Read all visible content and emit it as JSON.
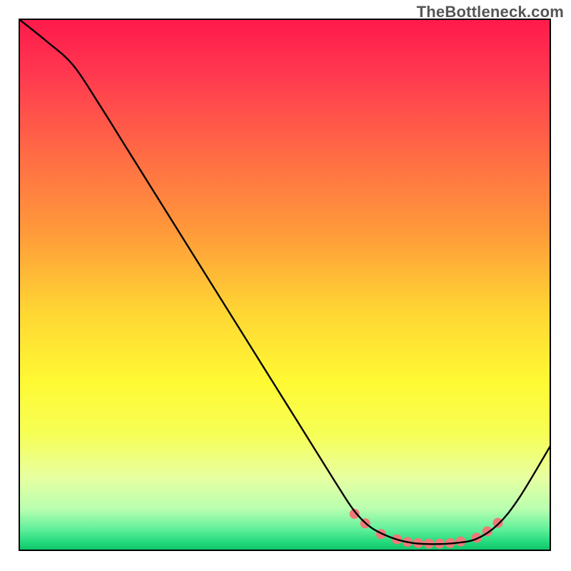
{
  "watermark": "TheBottleneck.com",
  "chart_data": {
    "type": "line",
    "title": "",
    "xlabel": "",
    "ylabel": "",
    "xlim": [
      0,
      100
    ],
    "ylim": [
      0,
      100
    ],
    "series": [
      {
        "name": "curve",
        "x": [
          0,
          5,
          10,
          15,
          20,
          25,
          30,
          35,
          40,
          45,
          50,
          55,
          60,
          63,
          66,
          70,
          74,
          78,
          82,
          86,
          90,
          94,
          100
        ],
        "y": [
          100,
          96,
          91.5,
          84,
          76,
          68,
          60,
          52,
          44,
          36,
          28,
          20,
          12,
          7.5,
          4.5,
          2.5,
          1.5,
          1.3,
          1.5,
          2.3,
          5,
          10,
          20
        ]
      }
    ],
    "markers": {
      "x": [
        63,
        65,
        68,
        71,
        73,
        75,
        77,
        79,
        81,
        83,
        86,
        88,
        90
      ],
      "y": [
        7.0,
        5.2,
        3.2,
        2.2,
        1.7,
        1.5,
        1.4,
        1.4,
        1.5,
        1.8,
        2.5,
        3.7,
        5.3
      ],
      "color": "#f07878",
      "radius_px": 7
    },
    "background_gradient_stops": [
      {
        "offset": 0.0,
        "color": "#ff1a4b"
      },
      {
        "offset": 0.1,
        "color": "#ff3850"
      },
      {
        "offset": 0.25,
        "color": "#ff6a45"
      },
      {
        "offset": 0.4,
        "color": "#ff9a3a"
      },
      {
        "offset": 0.55,
        "color": "#ffd633"
      },
      {
        "offset": 0.68,
        "color": "#fff933"
      },
      {
        "offset": 0.78,
        "color": "#f6ff55"
      },
      {
        "offset": 0.86,
        "color": "#e8ffa0"
      },
      {
        "offset": 0.92,
        "color": "#baffb0"
      },
      {
        "offset": 0.96,
        "color": "#5eef9a"
      },
      {
        "offset": 0.985,
        "color": "#1fd87a"
      },
      {
        "offset": 1.0,
        "color": "#0fbf66"
      }
    ]
  }
}
